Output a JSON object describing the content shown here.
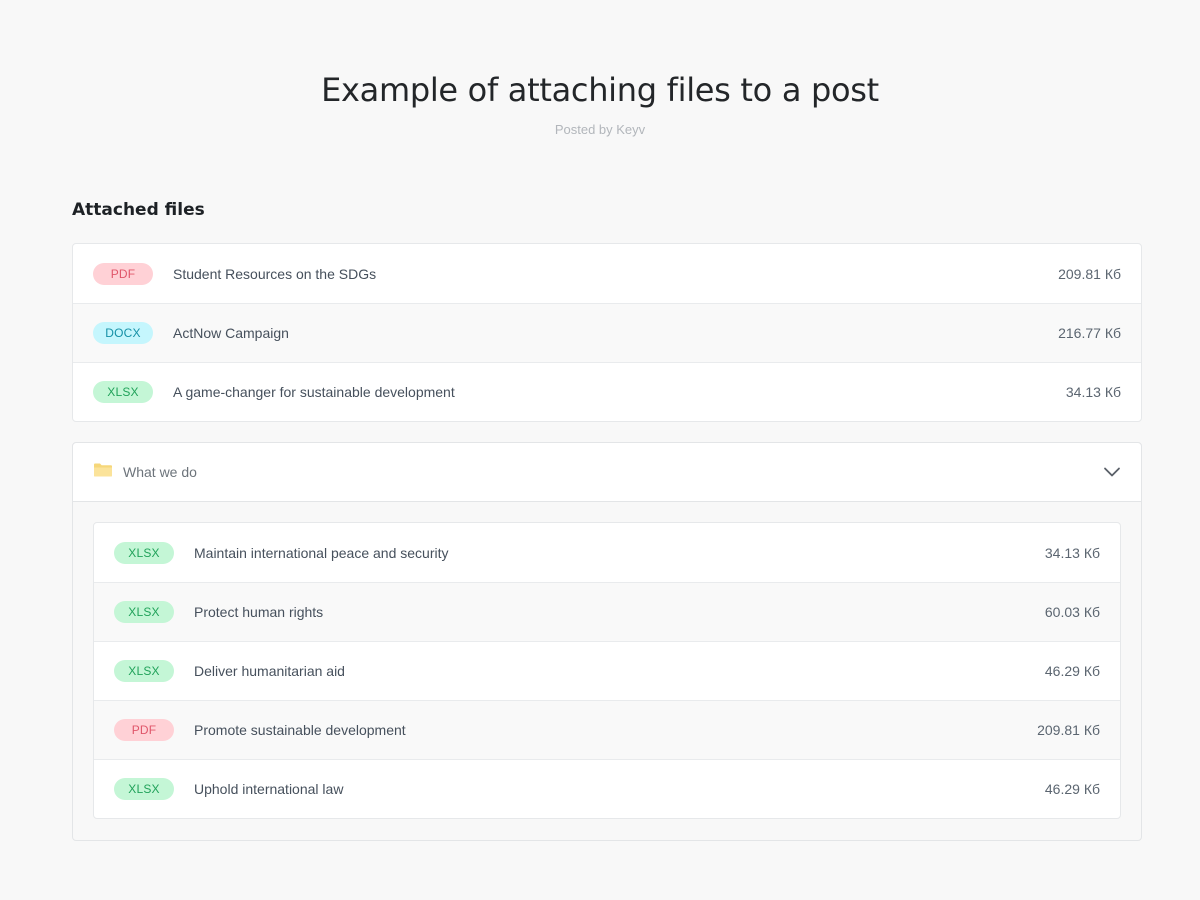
{
  "post": {
    "title": "Example of attaching files to a post",
    "meta": "Posted by Keyv"
  },
  "attachments": {
    "heading": "Attached files",
    "files": [
      {
        "type": "PDF",
        "name": "Student Resources on the SDGs",
        "size": "209.81 Кб"
      },
      {
        "type": "DOCX",
        "name": "ActNow Campaign",
        "size": "216.77 Кб"
      },
      {
        "type": "XLSX",
        "name": "A game-changer for sustainable development",
        "size": "34.13 Кб"
      }
    ],
    "folder": {
      "name": "What we do",
      "icon": "folder-icon",
      "toggle_icon": "chevron-down-icon",
      "expanded": true,
      "files": [
        {
          "type": "XLSX",
          "name": "Maintain international peace and security",
          "size": "34.13 Кб"
        },
        {
          "type": "XLSX",
          "name": "Protect human rights",
          "size": "60.03 Кб"
        },
        {
          "type": "XLSX",
          "name": "Deliver humanitarian aid",
          "size": "46.29 Кб"
        },
        {
          "type": "PDF",
          "name": "Promote sustainable development",
          "size": "209.81 Кб"
        },
        {
          "type": "XLSX",
          "name": "Uphold international law",
          "size": "46.29 Кб"
        }
      ]
    }
  },
  "colors": {
    "pdf": "#ffd1d6",
    "docx": "#c5f6fd",
    "xlsx": "#c4f6d6",
    "folder": "#f6d77a"
  }
}
